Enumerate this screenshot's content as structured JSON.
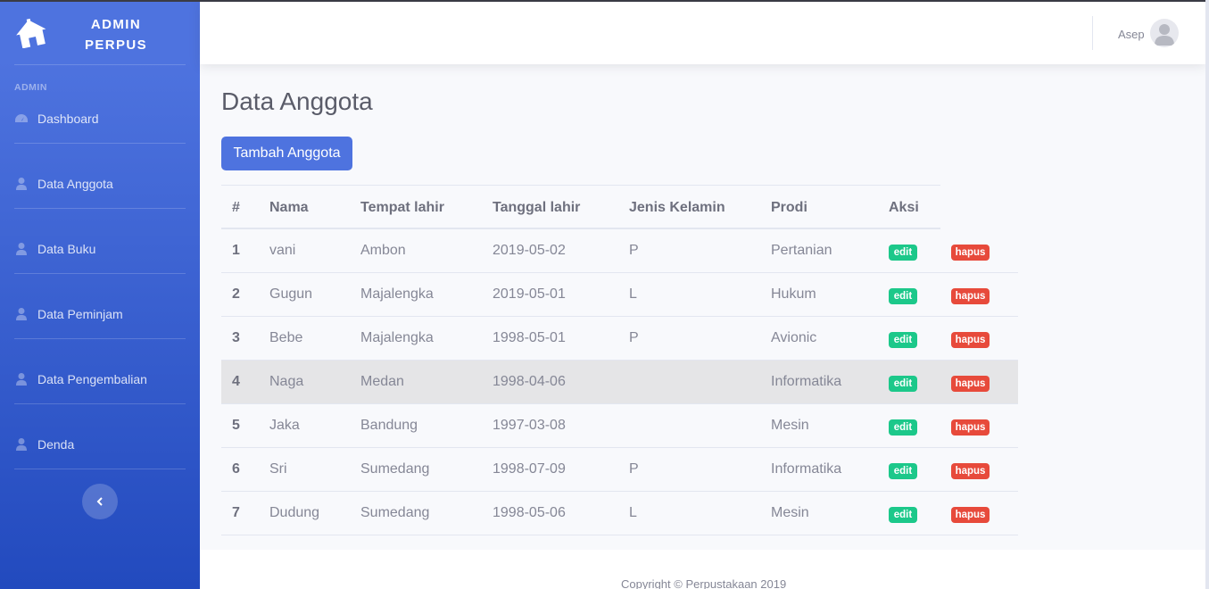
{
  "sidebar": {
    "brand_line1": "ADMIN",
    "brand_line2": "PERPUS",
    "heading": "ADMIN",
    "items": [
      {
        "label": "Dashboard",
        "icon": "dashboard-icon"
      },
      {
        "label": "Data Anggota",
        "icon": "user-icon"
      },
      {
        "label": "Data Buku",
        "icon": "user-icon"
      },
      {
        "label": "Data Peminjam",
        "icon": "user-icon"
      },
      {
        "label": "Data Pengembalian",
        "icon": "user-icon"
      },
      {
        "label": "Denda",
        "icon": "user-icon"
      }
    ]
  },
  "topbar": {
    "user_name": "Asep"
  },
  "main": {
    "title": "Data Anggota",
    "add_button": "Tambah Anggota",
    "table": {
      "headers": [
        "#",
        "Nama",
        "Tempat lahir",
        "Tanggal lahir",
        "Jenis Kelamin",
        "Prodi",
        "Aksi"
      ],
      "edit_label": "edit",
      "delete_label": "hapus",
      "rows": [
        {
          "no": "1",
          "nama": "vani",
          "tempat": "Ambon",
          "tanggal": "2019-05-02",
          "jk": "P",
          "prodi": "Pertanian"
        },
        {
          "no": "2",
          "nama": "Gugun",
          "tempat": "Majalengka",
          "tanggal": "2019-05-01",
          "jk": "L",
          "prodi": "Hukum"
        },
        {
          "no": "3",
          "nama": "Bebe",
          "tempat": "Majalengka",
          "tanggal": "1998-05-01",
          "jk": "P",
          "prodi": "Avionic"
        },
        {
          "no": "4",
          "nama": "Naga",
          "tempat": "Medan",
          "tanggal": "1998-04-06",
          "jk": "",
          "prodi": "Informatika"
        },
        {
          "no": "5",
          "nama": "Jaka",
          "tempat": "Bandung",
          "tanggal": "1997-03-08",
          "jk": "",
          "prodi": "Mesin"
        },
        {
          "no": "6",
          "nama": "Sri",
          "tempat": "Sumedang",
          "tanggal": "1998-07-09",
          "jk": "P",
          "prodi": "Informatika"
        },
        {
          "no": "7",
          "nama": "Dudung",
          "tempat": "Sumedang",
          "tanggal": "1998-05-06",
          "jk": "L",
          "prodi": "Mesin"
        }
      ],
      "highlighted_row": 4
    }
  },
  "footer": {
    "text": "Copyright © Perpustakaan 2019"
  },
  "colors": {
    "primary": "#4e73df",
    "success": "#1cc88a",
    "danger": "#e74a3b"
  }
}
